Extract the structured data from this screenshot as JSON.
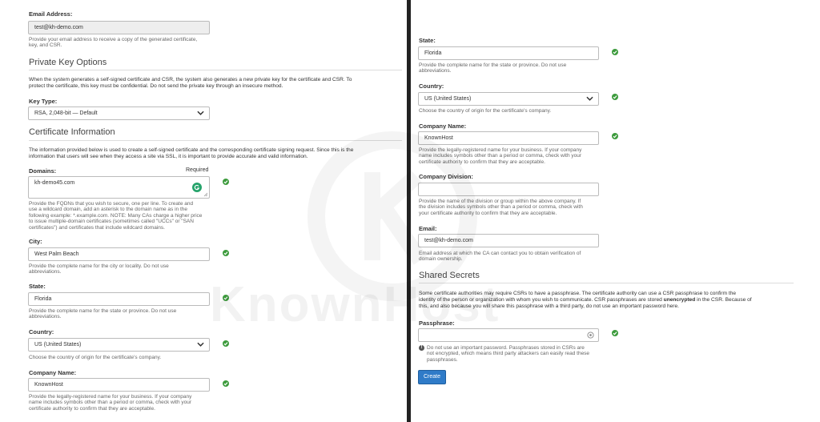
{
  "left": {
    "email_label": "Email Address:",
    "email_value": "test@kh-demo.com",
    "email_help": [
      "Provide your email address to receive a copy of the generated certificate,",
      "key, and CSR."
    ],
    "private_key_heading": "Private Key Options",
    "private_key_desc": [
      "When the system generates a self-signed certificate and CSR, the system also generates a new private key for the certificate and CSR. To",
      "protect the certificate, this key must be confidential. Do not send the private key through an insecure method."
    ],
    "key_type_label": "Key Type:",
    "key_type_value": "RSA, 2,048-bit — Default",
    "cert_info_heading": "Certificate Information",
    "cert_info_desc": [
      "The information provided below is used to create a self-signed certificate and the corresponding certificate signing request. Since this is the",
      "information that users will see when they access a site via SSL, it is important to provide accurate and valid information."
    ],
    "domains_label": "Domains:",
    "required_label": "Required",
    "domains_value": "kh-demo45.com",
    "domains_help": [
      "Provide the FQDNs that you wish to secure, one per line. To create and",
      "use a wildcard domain, add an asterisk to the domain name as in the",
      "following example: *.example.com. NOTE: Many CAs charge a higher price",
      "to issue multiple-domain certificates (sometimes called \"UCCs\" or \"SAN",
      "certificates\") and certificates that include wildcard domains."
    ],
    "city_label": "City:",
    "city_value": "West Palm Beach",
    "city_help": [
      "Provide the complete name for the city or locality. Do not use",
      "abbreviations."
    ],
    "state_label": "State:",
    "state_value": "Florida",
    "state_help": [
      "Provide the complete name for the state or province. Do not use",
      "abbreviations."
    ],
    "country_label": "Country:",
    "country_value": "US (United States)",
    "country_help": [
      "Choose the country of origin for the certificate's company."
    ],
    "company_label": "Company Name:",
    "company_value": "KnownHost",
    "company_help": [
      "Provide the legally-registered name for your business. If your company",
      "name includes symbols other than a period or comma, check with your",
      "certificate authority to confirm that they are acceptable."
    ]
  },
  "right": {
    "state_label": "State:",
    "state_value": "Florida",
    "state_help": [
      "Provide the complete name for the state or province. Do not use",
      "abbreviations."
    ],
    "country_label": "Country:",
    "country_value": "US (United States)",
    "country_help": [
      "Choose the country of origin for the certificate's company."
    ],
    "company_label": "Company Name:",
    "company_value": "KnownHost",
    "company_help": [
      "Provide the legally-registered name for your business. If your company",
      "name includes symbols other than a period or comma, check with your",
      "certificate authority to confirm that they are acceptable."
    ],
    "division_label": "Company Division:",
    "division_value": "",
    "division_help": [
      "Provide the name of the division or group within the above company. If",
      "the division includes symbols other than a period or comma, check with",
      "your certificate authority to confirm that they are acceptable."
    ],
    "email_label": "Email:",
    "email_value": "test@kh-demo.com",
    "email_help": [
      "Email address at which the CA can contact you to obtain verification of",
      "domain ownership."
    ],
    "shared_secrets_heading": "Shared Secrets",
    "shared_desc_1": "Some certificate authorities may require CSRs to have a passphrase. The certificate authority can use a CSR passphrase to confirm the",
    "shared_desc_2a": "identity of the person or organization with whom you wish to communicate. CSR passphrases are stored ",
    "shared_desc_2b": "unencrypted",
    "shared_desc_2c": " in the CSR. Because of",
    "shared_desc_3": "this, and also because you will share this passphrase with a third party, do not use an important password here.",
    "passphrase_label": "Passphrase:",
    "passphrase_value": "",
    "passphrase_warning": [
      "Do not use an important password. Passphrases stored in CSRs are",
      "not encrypted, which means third party attackers can easily read these",
      "passphrases."
    ],
    "create_button": "Create"
  },
  "watermark": "KnownHost",
  "colors": {
    "check_green": "#3d9b3d",
    "button_blue": "#2f7bc8",
    "grammarly_green": "#26a36b"
  }
}
